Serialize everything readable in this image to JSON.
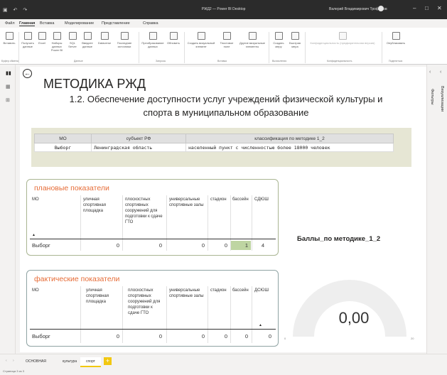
{
  "window": {
    "title": "РЖД2 — Power BI Desktop",
    "user": "Валерий Владимирович Трофимов"
  },
  "menu": [
    "Файл",
    "Главная",
    "Вставка",
    "Моделирование",
    "Представление",
    "Справка"
  ],
  "ribbon": {
    "buttons": [
      {
        "label": "Вставить"
      },
      {
        "label": "Получить данные"
      },
      {
        "label": "Excel"
      },
      {
        "label": "Наборы данных Power BI"
      },
      {
        "label": "SQL Server"
      },
      {
        "label": "Введите данные"
      },
      {
        "label": "Dataverse"
      },
      {
        "label": "Последние источники"
      },
      {
        "label": "Преобразование данных"
      },
      {
        "label": "Обновить"
      },
      {
        "label": "Создать визуальный элемент"
      },
      {
        "label": "Текстовое поле"
      },
      {
        "label": "Другие визуальные элементы"
      },
      {
        "label": "Создать меру"
      },
      {
        "label": "Быстрая мера"
      },
      {
        "label": "Конфиденциальность (предварительная версия)"
      },
      {
        "label": "Опубликовать"
      }
    ],
    "groups": [
      "Буфер обмена",
      "Данные",
      "Запросы",
      "Вставка",
      "Вычисления",
      "Конфиденциальность",
      "Поделиться"
    ]
  },
  "right_panes": [
    "Визуализации",
    "Фильтры"
  ],
  "report": {
    "title": "МЕТОДИКА РЖД",
    "subtitle": "1.2. Обеспечение доступности услуг учреждений физической культуры и спорта в муниципальном образование"
  },
  "class_table": {
    "headers": [
      "МО",
      "субъект РФ",
      "классификация по методике 1_2"
    ],
    "row": [
      "Выборг",
      "Ленинградская область",
      "населенный пункт с численностью более 18000 человек"
    ]
  },
  "planned": {
    "title": "плановые показатели",
    "headers": [
      "МО",
      "уличная спортивная площадка",
      "плоскостных спортивных сооружений для подготовки к сдаче ГТО",
      "универсальные спортивные залы",
      "стадион",
      "бассейн",
      "СДЮШ"
    ],
    "row": [
      "Выборг",
      "0",
      "0",
      "0",
      "0",
      "1",
      "4"
    ]
  },
  "actual": {
    "title": "фактические показатели",
    "headers": [
      "МО",
      "уличная спортивная площадка",
      "плоскостных спортивных сооружений для подготовки к сдаче ГТО",
      "универсальные спортивные залы",
      "стадион",
      "бассейн",
      "ДСЮШ"
    ],
    "row": [
      "Выборг",
      "0",
      "0",
      "0",
      "0",
      "0",
      "0"
    ]
  },
  "gauge": {
    "title": "Баллы_по методике_1_2",
    "value": "0,00",
    "min": "0",
    "max": "20",
    "fraction": 0
  },
  "tabs": [
    "ОСНОВНАЯ",
    "культура",
    "спорт"
  ],
  "active_tab": "спорт",
  "status": "Страница 3 из 3",
  "colors": {
    "accent": "#f2c811",
    "section_title": "#e66c37",
    "highlight": "#bed5a2",
    "gauge_track": "#eeeeee"
  }
}
